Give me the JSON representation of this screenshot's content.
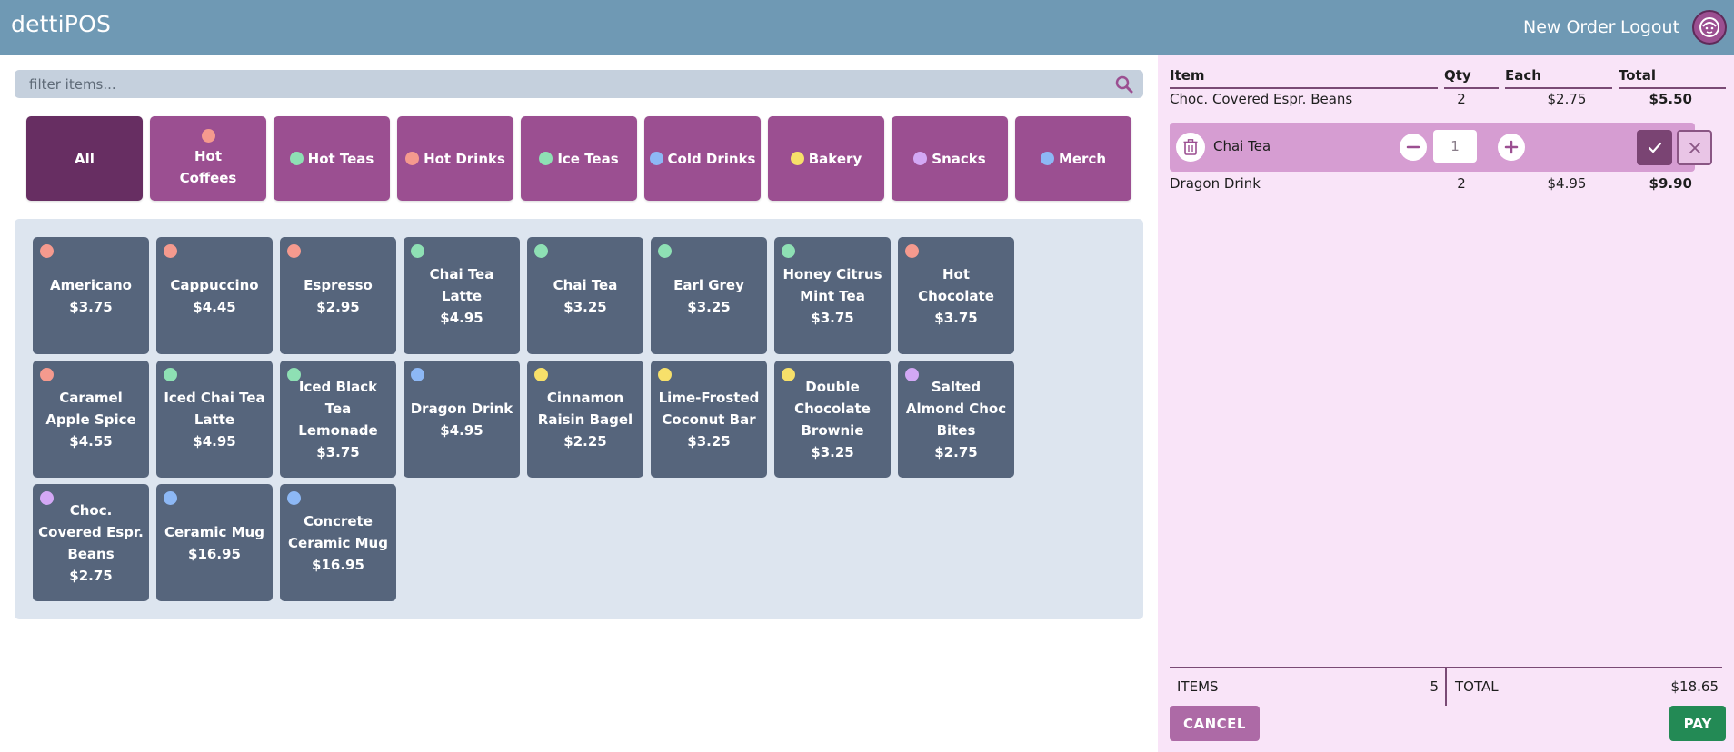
{
  "app": {
    "title": "dettiPOS"
  },
  "nav": {
    "new_order": "New Order",
    "logout": "Logout"
  },
  "search": {
    "placeholder": "filter items..."
  },
  "colors": {
    "red": "#f59a8e",
    "green": "#8ee0b4",
    "blue": "#8db8f5",
    "yellow": "#f7e06a",
    "purple": "#d3a8f5"
  },
  "categories": [
    {
      "label": "All",
      "dot": null,
      "active": true
    },
    {
      "label": "Hot Coffees",
      "dot": "red",
      "active": false
    },
    {
      "label": "Hot Teas",
      "dot": "green",
      "active": false
    },
    {
      "label": "Hot Drinks",
      "dot": "red",
      "active": false
    },
    {
      "label": "Ice Teas",
      "dot": "green",
      "active": false
    },
    {
      "label": "Cold Drinks",
      "dot": "blue",
      "active": false
    },
    {
      "label": "Bakery",
      "dot": "yellow",
      "active": false
    },
    {
      "label": "Snacks",
      "dot": "purple",
      "active": false
    },
    {
      "label": "Merch",
      "dot": "blue",
      "active": false
    }
  ],
  "items": [
    {
      "name": "Americano",
      "price": "$3.75",
      "dot": "red"
    },
    {
      "name": "Cappuccino",
      "price": "$4.45",
      "dot": "red"
    },
    {
      "name": "Espresso",
      "price": "$2.95",
      "dot": "red"
    },
    {
      "name": "Chai Tea Latte",
      "price": "$4.95",
      "dot": "green"
    },
    {
      "name": "Chai Tea",
      "price": "$3.25",
      "dot": "green"
    },
    {
      "name": "Earl Grey",
      "price": "$3.25",
      "dot": "green"
    },
    {
      "name": "Honey Citrus Mint Tea",
      "price": "$3.75",
      "dot": "green"
    },
    {
      "name": "Hot Chocolate",
      "price": "$3.75",
      "dot": "red"
    },
    {
      "name": "Caramel Apple Spice",
      "price": "$4.55",
      "dot": "red"
    },
    {
      "name": "Iced Chai Tea Latte",
      "price": "$4.95",
      "dot": "green"
    },
    {
      "name": "Iced Black Tea Lemonade",
      "price": "$3.75",
      "dot": "green"
    },
    {
      "name": "Dragon Drink",
      "price": "$4.95",
      "dot": "blue"
    },
    {
      "name": "Cinnamon Raisin Bagel",
      "price": "$2.25",
      "dot": "yellow"
    },
    {
      "name": "Lime-Frosted Coconut Bar",
      "price": "$3.25",
      "dot": "yellow"
    },
    {
      "name": "Double Chocolate Brownie",
      "price": "$3.25",
      "dot": "yellow"
    },
    {
      "name": "Salted Almond Choc Bites",
      "price": "$2.75",
      "dot": "purple"
    },
    {
      "name": "Choc. Covered Espr. Beans",
      "price": "$2.75",
      "dot": "purple"
    },
    {
      "name": "Ceramic Mug",
      "price": "$16.95",
      "dot": "blue"
    },
    {
      "name": "Concrete Ceramic Mug",
      "price": "$16.95",
      "dot": "blue"
    }
  ],
  "order": {
    "headers": {
      "item": "Item",
      "qty": "Qty",
      "each": "Each",
      "total": "Total"
    },
    "lines": [
      {
        "item": "Choc. Covered Espr. Beans",
        "qty": "2",
        "each": "$2.75",
        "total": "$5.50"
      },
      {
        "item": "Dragon Drink",
        "qty": "2",
        "each": "$4.95",
        "total": "$9.90"
      }
    ],
    "editing": {
      "item": "Chai Tea",
      "qty": "1"
    },
    "summary": {
      "items_label": "ITEMS",
      "items_count": "5",
      "total_label": "TOTAL",
      "total_value": "$18.65"
    },
    "buttons": {
      "cancel": "CANCEL",
      "pay": "PAY"
    }
  }
}
